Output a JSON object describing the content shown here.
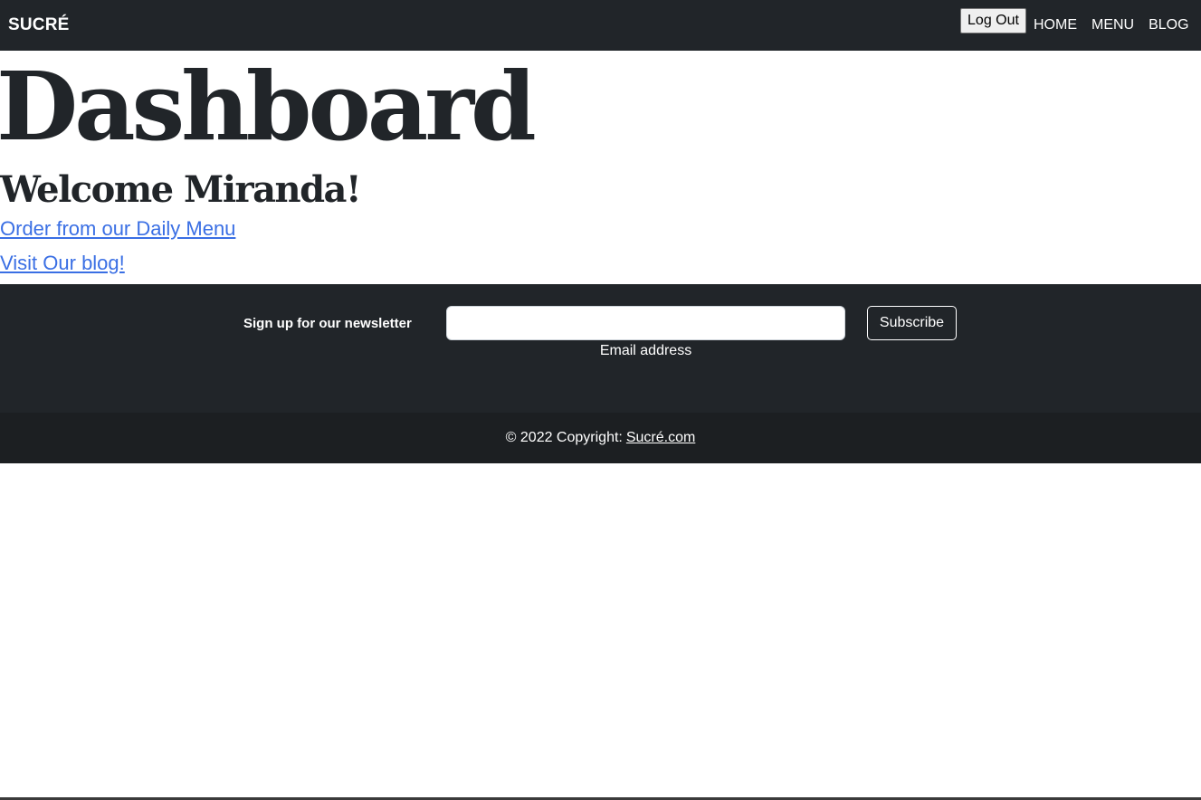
{
  "navbar": {
    "brand": "SUCRÉ",
    "logout_label": "Log Out",
    "links": [
      "HOME",
      "MENU",
      "BLOG"
    ]
  },
  "main": {
    "title": "Dashboard",
    "welcome": "Welcome Miranda!",
    "order_link": "Order from our Daily Menu",
    "blog_link": "Visit Our blog!"
  },
  "newsletter": {
    "label": "Sign up for our newsletter",
    "email_value": "",
    "email_label": "Email address",
    "subscribe_label": "Subscribe"
  },
  "footer": {
    "copyright": "© 2022 Copyright:",
    "site_link": "Sucré.com"
  },
  "colors": {
    "navbar_bg": "#212529",
    "footer_bg": "#1c1f22",
    "link": "#3a6fe4"
  }
}
